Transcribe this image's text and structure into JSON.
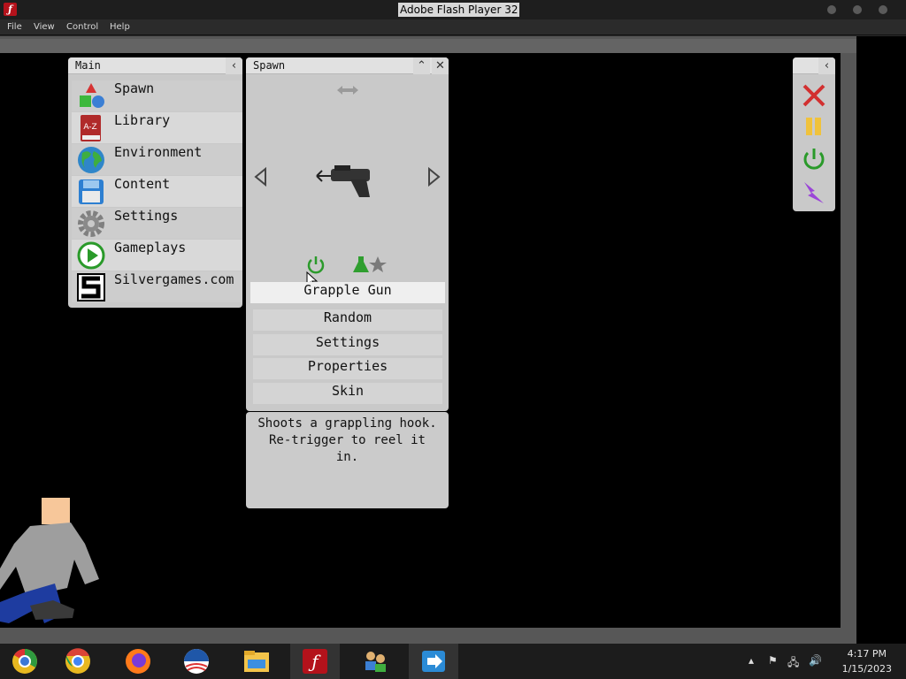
{
  "window": {
    "title": "Adobe Flash Player 32",
    "app_icon": "flash-icon"
  },
  "menu": {
    "items": [
      "File",
      "View",
      "Control",
      "Help"
    ]
  },
  "main_panel": {
    "title": "Main",
    "collapse_icon": "chevron-left-icon",
    "items": [
      {
        "label": "Spawn",
        "icon": "shapes-icon"
      },
      {
        "label": "Library",
        "icon": "book-icon"
      },
      {
        "label": "Environment",
        "icon": "globe-icon"
      },
      {
        "label": "Content",
        "icon": "floppy-disk-icon"
      },
      {
        "label": "Settings",
        "icon": "gear-icon"
      },
      {
        "label": "Gameplays",
        "icon": "play-icon"
      },
      {
        "label": "Silvergames.com",
        "icon": "silvergames-logo-icon"
      }
    ]
  },
  "spawn_panel": {
    "title": "Spawn",
    "selected": "Grapple Gun",
    "buttons": [
      "Random",
      "Settings",
      "Properties",
      "Skin"
    ],
    "description": "Shoots a grappling hook.\nRe-trigger to reel it\nin."
  },
  "tools_panel": {
    "tools": [
      "close-x-icon",
      "pause-icon",
      "reset-power-icon",
      "lightning-icon"
    ]
  },
  "taskbar": {
    "apps": [
      "chrome-legacy-icon",
      "chrome-icon",
      "firefox-icon",
      "obama-logo-icon",
      "file-explorer-icon",
      "flash-player-icon",
      "network-people-icon",
      "remote-desktop-icon"
    ],
    "time": "4:17 PM",
    "date": "1/15/2023"
  }
}
